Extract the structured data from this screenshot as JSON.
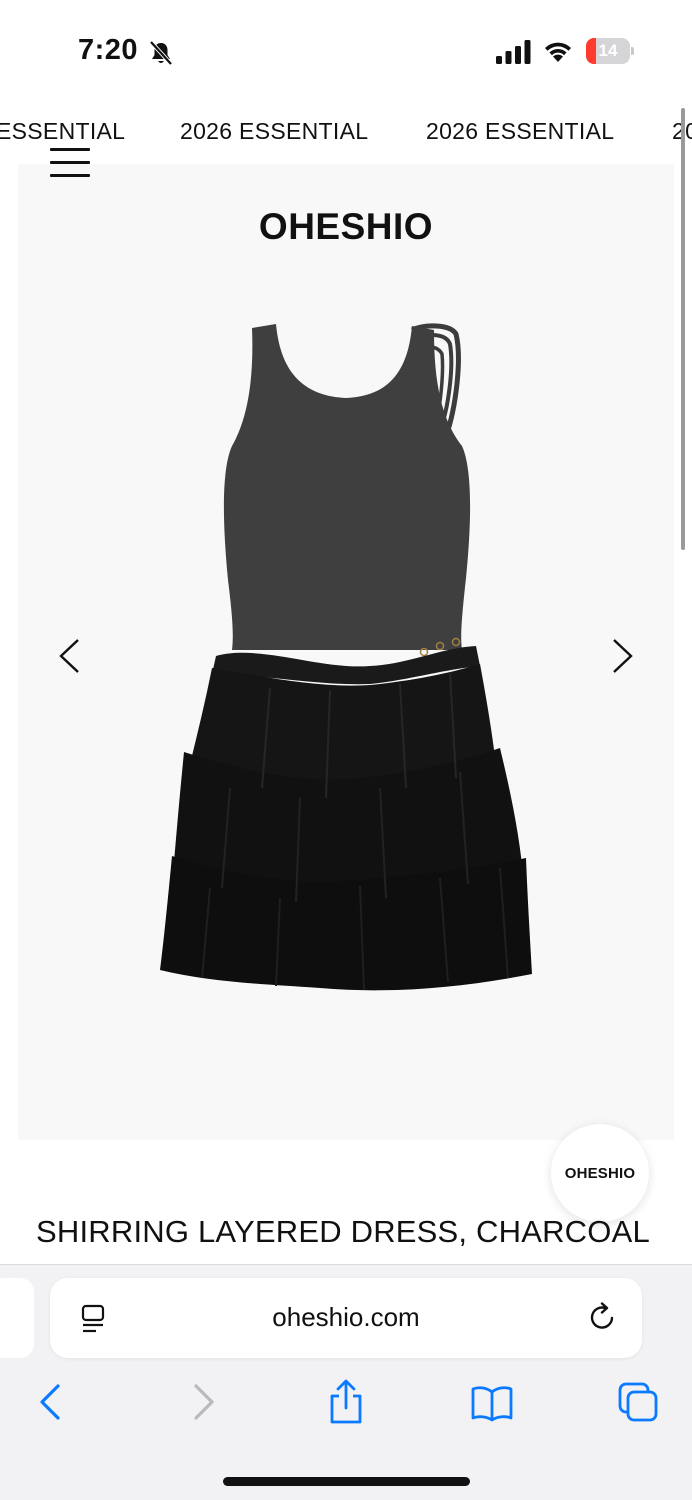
{
  "status_bar": {
    "time": "7:20",
    "battery_level": "14",
    "icons": [
      "bell-slash-icon",
      "signal-icon",
      "wifi-icon",
      "battery-icon"
    ],
    "battery_color": "#ff3b30"
  },
  "marquee": {
    "items": [
      "ESSENTIAL",
      "2026 ESSENTIAL",
      "2026 ESSENTIAL",
      "20"
    ]
  },
  "header": {
    "brand": "OHESHIO",
    "menu_icon": "hamburger-menu-icon"
  },
  "gallery": {
    "prev_icon": "chevron-left-icon",
    "next_icon": "chevron-right-icon"
  },
  "product": {
    "title": "SHIRRING LAYERED DRESS, CHARCOAL"
  },
  "floating_button": {
    "label": "OHESHIO"
  },
  "browser": {
    "url": "oheshio.com",
    "page_menu_icon": "page-menu-icon",
    "reload_icon": "reload-icon",
    "toolbar": [
      "back-icon",
      "forward-icon",
      "share-icon",
      "bookmarks-icon",
      "tabs-icon"
    ],
    "accent_color": "#0a7aff"
  }
}
